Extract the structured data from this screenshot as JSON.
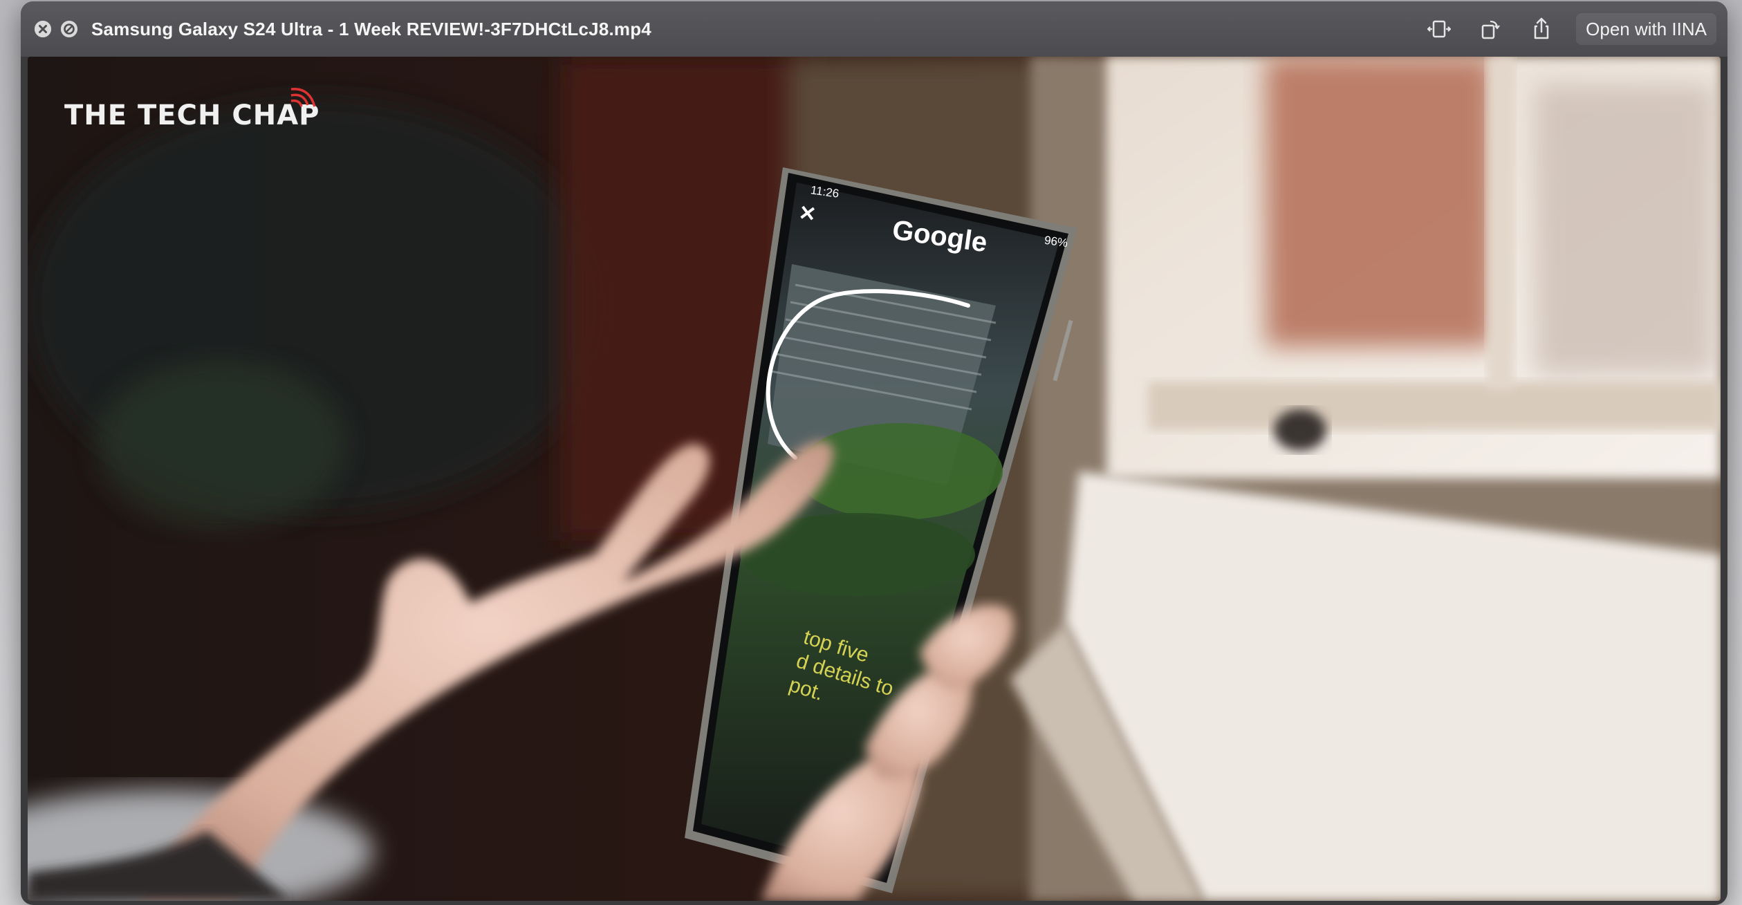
{
  "window": {
    "title": "Samsung Galaxy S24 Ultra - 1 Week REVIEW!-3F7DHCtLcJ8.mp4",
    "open_with_label": "Open with IINA"
  },
  "icons": {
    "close": "close-icon",
    "disable": "disable-icon",
    "resize": "resize-icon",
    "rotate": "rotate-icon",
    "share": "share-icon"
  },
  "video": {
    "channel_logo": "THE TECH CHAP",
    "phone_screen": {
      "time": "11:26",
      "brand": "Google",
      "battery": "96%",
      "close_glyph": "✕",
      "caption": "top five\nd details to\npot."
    }
  },
  "colors": {
    "titlebar": "#4e4e52",
    "window": "#3a3a3d",
    "caption": "#e8e35a"
  }
}
